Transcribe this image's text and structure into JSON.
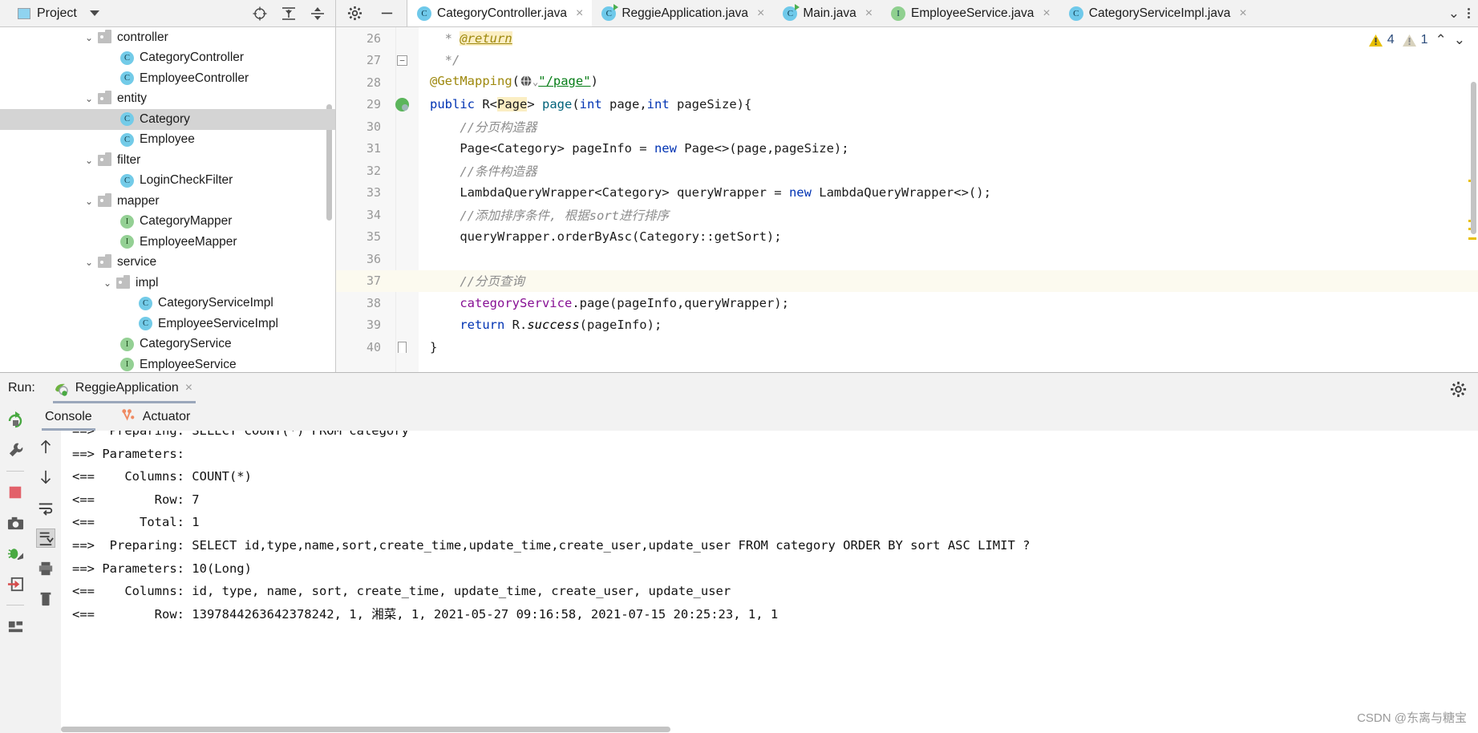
{
  "project_panel": {
    "title": "Project",
    "icons": [
      "locate-icon",
      "expand-all-icon",
      "collapse-all-icon",
      "settings-gear-icon",
      "minimize-icon"
    ],
    "tree": [
      {
        "label": "controller",
        "type": "folder",
        "indent": 1,
        "expanded": true,
        "selected": false
      },
      {
        "label": "CategoryController",
        "type": "class",
        "indent": 3,
        "expanded": false,
        "selected": false
      },
      {
        "label": "EmployeeController",
        "type": "class",
        "indent": 3,
        "expanded": false,
        "selected": false
      },
      {
        "label": "entity",
        "type": "folder",
        "indent": 1,
        "expanded": true,
        "selected": false
      },
      {
        "label": "Category",
        "type": "class",
        "indent": 3,
        "expanded": false,
        "selected": true
      },
      {
        "label": "Employee",
        "type": "class",
        "indent": 3,
        "expanded": false,
        "selected": false
      },
      {
        "label": "filter",
        "type": "folder",
        "indent": 1,
        "expanded": true,
        "selected": false
      },
      {
        "label": "LoginCheckFilter",
        "type": "class",
        "indent": 3,
        "expanded": false,
        "selected": false
      },
      {
        "label": "mapper",
        "type": "folder",
        "indent": 1,
        "expanded": true,
        "selected": false
      },
      {
        "label": "CategoryMapper",
        "type": "interface",
        "indent": 3,
        "expanded": false,
        "selected": false
      },
      {
        "label": "EmployeeMapper",
        "type": "interface",
        "indent": 3,
        "expanded": false,
        "selected": false
      },
      {
        "label": "service",
        "type": "folder",
        "indent": 1,
        "expanded": true,
        "selected": false
      },
      {
        "label": "impl",
        "type": "folder",
        "indent": 2,
        "expanded": true,
        "selected": false
      },
      {
        "label": "CategoryServiceImpl",
        "type": "class",
        "indent": 4,
        "expanded": false,
        "selected": false
      },
      {
        "label": "EmployeeServiceImpl",
        "type": "class",
        "indent": 4,
        "expanded": false,
        "selected": false
      },
      {
        "label": "CategoryService",
        "type": "interface",
        "indent": 3,
        "expanded": false,
        "selected": false
      },
      {
        "label": "EmployeeService",
        "type": "interface",
        "indent": 3,
        "expanded": false,
        "selected": false
      }
    ]
  },
  "editor_tabs": [
    {
      "label": "CategoryController.java",
      "icon": "class-icon",
      "active": true
    },
    {
      "label": "ReggieApplication.java",
      "icon": "spring-class-icon",
      "active": false
    },
    {
      "label": "Main.java",
      "icon": "spring-class-icon",
      "active": false
    },
    {
      "label": "EmployeeService.java",
      "icon": "interface-icon",
      "active": false
    },
    {
      "label": "CategoryServiceImpl.java",
      "icon": "class-icon",
      "active": false
    }
  ],
  "editor": {
    "inspection_warnings": "4",
    "inspection_weak_warnings": "1",
    "first_line_number": 26,
    "highlighted_line": 37,
    "lines": [
      {
        "n": 26,
        "html": "  <span class=\"cm\">* </span><span class=\"anch\">@return</span>"
      },
      {
        "n": 27,
        "html": "  <span class=\"cm\">*/</span>",
        "fold": "end"
      },
      {
        "n": 28,
        "html": "<span class=\"an\">@GetMapping</span>(<span class=\"gicon\"></span><span class=\"str\">\"/page\"</span>)"
      },
      {
        "n": 29,
        "html": "<span class=\"k\">public</span> R&lt;<span class=\"hlw\">Page</span>&gt; <span class=\"fn\">page</span>(<span class=\"k\">int</span> page,<span class=\"k\">int</span> pageSize){",
        "gutter": "bean",
        "fold": "start"
      },
      {
        "n": 30,
        "html": "    <span class=\"cm\">//分页构造器</span>"
      },
      {
        "n": 31,
        "html": "    Page&lt;Category&gt; pageInfo = <span class=\"k\">new</span> Page&lt;&gt;(page,pageSize);"
      },
      {
        "n": 32,
        "html": "    <span class=\"cm\">//条件构造器</span>"
      },
      {
        "n": 33,
        "html": "    LambdaQueryWrapper&lt;Category&gt; queryWrapper = <span class=\"k\">new</span> LambdaQueryWrapper&lt;&gt;();"
      },
      {
        "n": 34,
        "html": "    <span class=\"cm\">//添加排序条件, 根据sort进行排序</span>"
      },
      {
        "n": 35,
        "html": "    queryWrapper.orderByAsc(Category::getSort);"
      },
      {
        "n": 36,
        "html": ""
      },
      {
        "n": 37,
        "html": "    <span class=\"cm\">//分页查询</span>"
      },
      {
        "n": 38,
        "html": "    <span class=\"fld\">categoryService</span>.page(pageInfo,queryWrapper);"
      },
      {
        "n": 39,
        "html": "    <span class=\"k\">return</span> R.<span class=\"ita\">success</span>(pageInfo);"
      },
      {
        "n": 40,
        "html": "}",
        "fold": "end2"
      }
    ]
  },
  "run_panel": {
    "run_label": "Run:",
    "configuration_name": "ReggieApplication",
    "close_label": "×",
    "settings_icon": "gear-icon",
    "left_toolbar": [
      "rerun-icon",
      "wrench-icon",
      "stop-icon",
      "camera-icon",
      "debug-icon",
      "export-icon",
      "layout-icon"
    ],
    "second_toolbar": [
      "scroll-up-icon",
      "scroll-down-icon",
      "soft-wrap-icon",
      "scroll-to-end-icon"
    ],
    "tabs": [
      {
        "label": "Console",
        "icon": "console-icon",
        "active": true
      },
      {
        "label": "Actuator",
        "icon": "actuator-icon",
        "active": false
      }
    ],
    "console_lines": [
      "==>  Preparing: SELECT COUNT(*) FROM category",
      "==> Parameters: ",
      "<==    Columns: COUNT(*)",
      "<==        Row: 7",
      "<==      Total: 1",
      "==>  Preparing: SELECT id,type,name,sort,create_time,update_time,create_user,update_user FROM category ORDER BY sort ASC LIMIT ?",
      "==> Parameters: 10(Long)",
      "<==    Columns: id, type, name, sort, create_time, update_time, create_user, update_user",
      "<==        Row: 1397844263642378242, 1, 湘菜, 1, 2021-05-27 09:16:58, 2021-07-15 20:25:23, 1, 1"
    ]
  },
  "watermark": "CSDN @东离与糖宝",
  "colors": {
    "accent_blue": "#6fc9ea",
    "interface_green": "#8fd08f",
    "keyword": "#0033b3",
    "string": "#067d17",
    "comment": "#8c8c8c",
    "annotation": "#9e880d",
    "field": "#871094",
    "highlight_line": "#fcfaef",
    "selection": "#d4d4d4"
  }
}
